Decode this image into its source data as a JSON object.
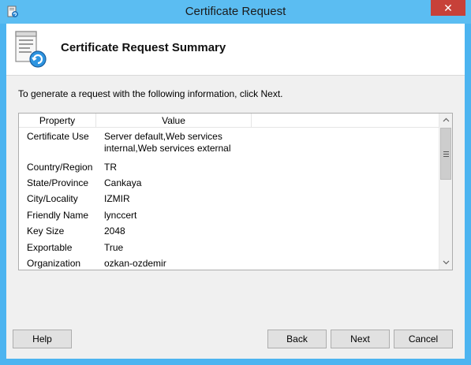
{
  "window": {
    "title": "Certificate Request",
    "close_glyph": "✕"
  },
  "header": {
    "title": "Certificate Request Summary",
    "icon": "certificate-request-icon"
  },
  "instruction": "To generate a request with the following information, click Next.",
  "table": {
    "columns": [
      "Property",
      "Value"
    ],
    "rows": [
      {
        "property": "Certificate Use",
        "value": "Server default,Web services internal,Web services external"
      },
      {
        "property": "Country/Region",
        "value": "TR"
      },
      {
        "property": "State/Province",
        "value": "Cankaya"
      },
      {
        "property": "City/Locality",
        "value": "IZMIR"
      },
      {
        "property": "Friendly Name",
        "value": "lynccert"
      },
      {
        "property": "Key Size",
        "value": "2048"
      },
      {
        "property": "Exportable",
        "value": "True"
      },
      {
        "property": "Organization",
        "value": "ozkan-ozdemir"
      }
    ]
  },
  "buttons": {
    "help": "Help",
    "back": "Back",
    "next": "Next",
    "cancel": "Cancel"
  },
  "colors": {
    "titlebar": "#5bbdf2",
    "close": "#c74139",
    "dialog_bg": "#f0f0f0"
  }
}
